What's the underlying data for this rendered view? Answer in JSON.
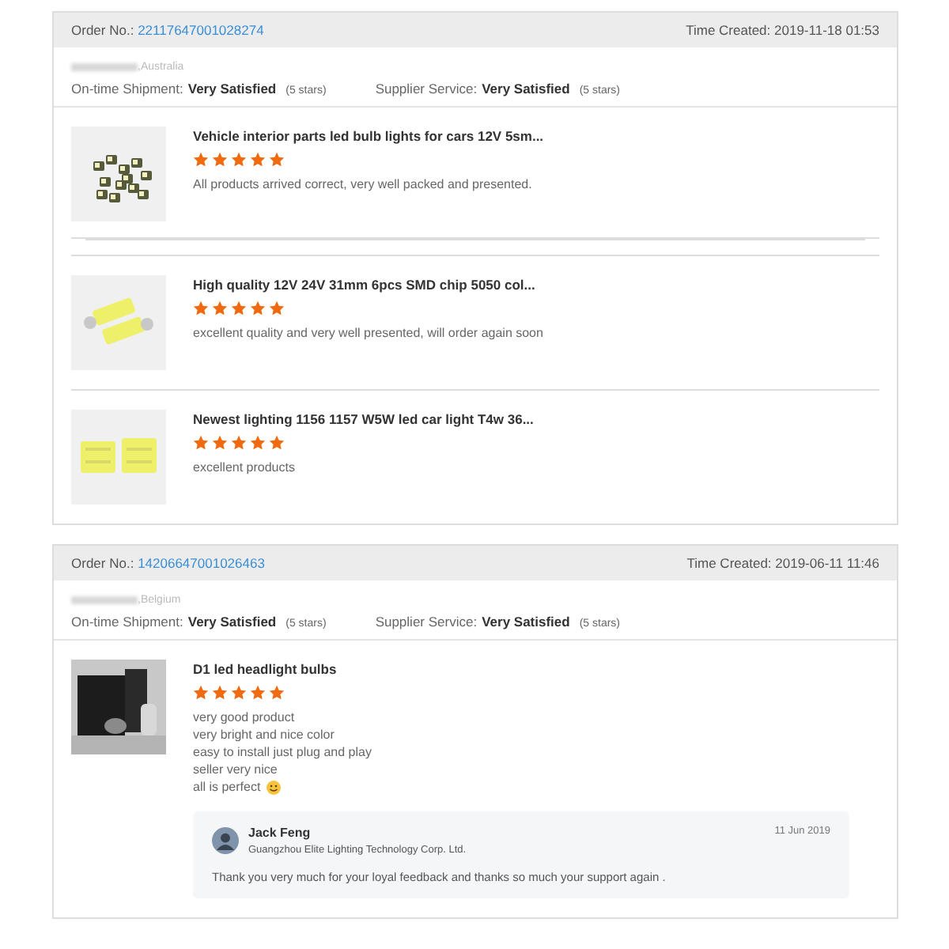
{
  "orders": [
    {
      "order_label": "Order No.:",
      "order_number": "22117647001028274",
      "time_created": "Time Created: 2019-11-18 01:53",
      "country": ",Australia",
      "shipment_label": "On-time Shipment:",
      "shipment_value": "Very Satisfied",
      "shipment_stars": "(5 stars)",
      "supplier_label": "Supplier Service:",
      "supplier_value": "Very Satisfied",
      "supplier_stars": "(5 stars)",
      "items": [
        {
          "title": "Vehicle interior parts led bulb lights for cars 12V 5sm...",
          "stars": 5,
          "lines": [
            "All products arrived correct, very well packed and presented."
          ],
          "smiley": false
        },
        {
          "title": "High quality 12V 24V 31mm 6pcs SMD chip 5050 col...",
          "stars": 5,
          "lines": [
            "excellent quality and very well presented, will order again soon"
          ],
          "smiley": false
        },
        {
          "title": "Newest lighting 1156 1157 W5W led car light T4w 36...",
          "stars": 5,
          "lines": [
            "excellent products"
          ],
          "smiley": false
        }
      ]
    },
    {
      "order_label": "Order No.:",
      "order_number": "14206647001026463",
      "time_created": "Time Created: 2019-06-11 11:46",
      "country": ",Belgium",
      "shipment_label": "On-time Shipment:",
      "shipment_value": "Very Satisfied",
      "shipment_stars": "(5 stars)",
      "supplier_label": "Supplier Service:",
      "supplier_value": "Very Satisfied",
      "supplier_stars": "(5 stars)",
      "items": [
        {
          "title": "D1 led headlight bulbs",
          "stars": 5,
          "lines": [
            "very good product",
            "very bright and nice color",
            "easy to install just plug and play",
            "seller very nice",
            "all is perfect"
          ],
          "smiley": true,
          "reply": {
            "name": "Jack Feng",
            "company": "Guangzhou Elite Lighting Technology Corp. Ltd.",
            "date": "11 Jun 2019",
            "text": "Thank you very much for your loyal feedback and thanks so much your support again ."
          }
        }
      ]
    }
  ]
}
